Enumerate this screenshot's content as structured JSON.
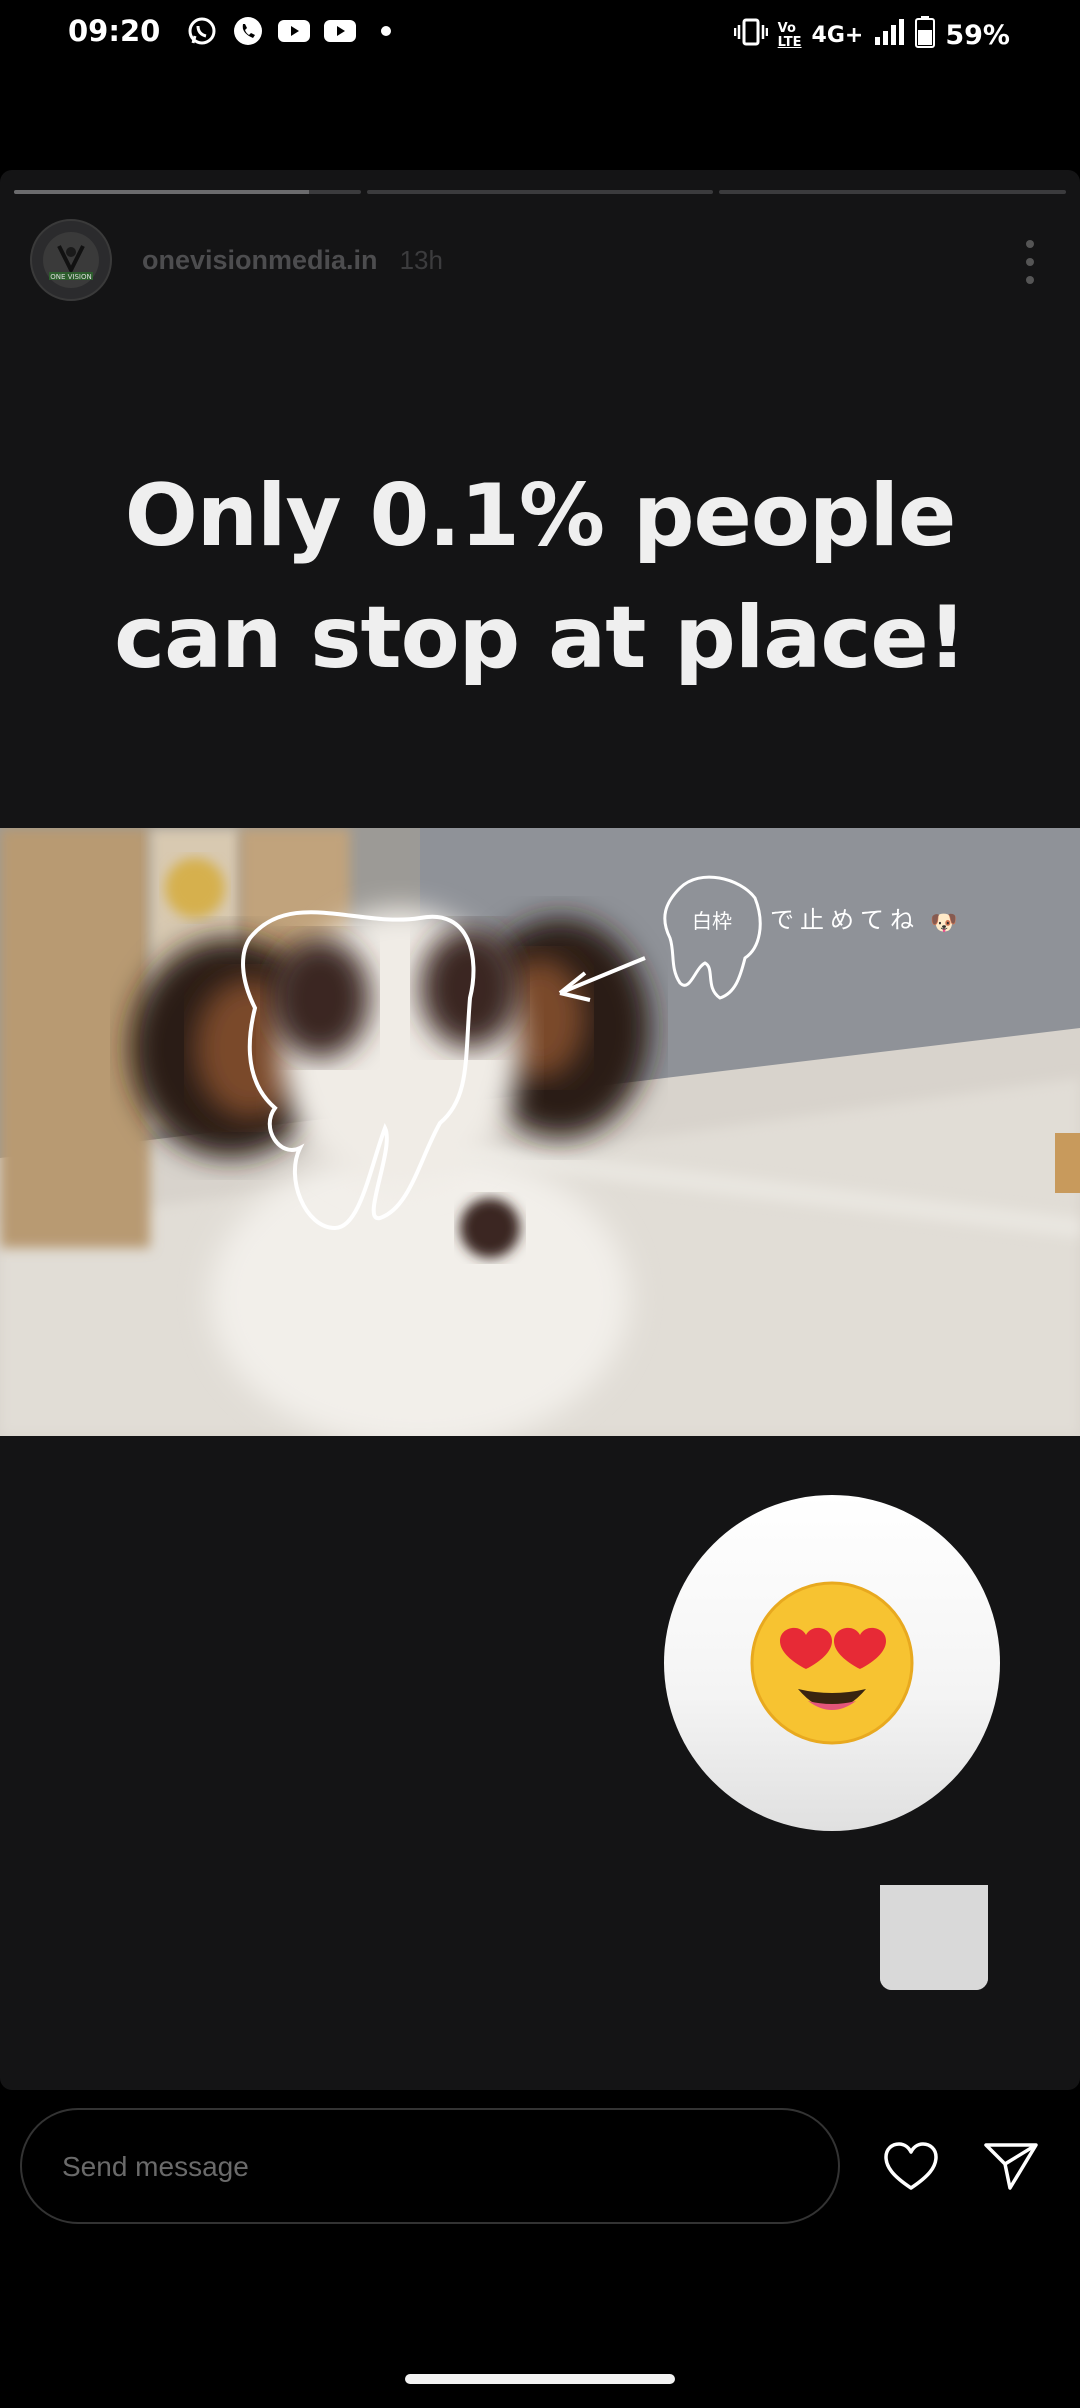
{
  "status_bar": {
    "time": "09:20",
    "notifications": [
      "whatsapp-icon",
      "phone-icon",
      "youtube-icon",
      "youtube-icon",
      "dot-icon"
    ],
    "network_vo": "Vo",
    "network_lte": "LTE",
    "network_type": "4G+",
    "battery_percent": "59%"
  },
  "story": {
    "progress": [
      0.85,
      0.0,
      0.0
    ],
    "author": "onevisionmedia.in",
    "time_ago": "13h",
    "avatar_text": "ONE VISION",
    "headline_line1": "Only 0.1% people",
    "headline_line2": "can stop at place!",
    "video_annotation_box": "白枠",
    "video_annotation_text": "で止めてね",
    "reaction_emoji": "😍"
  },
  "composer": {
    "placeholder": "Send message"
  },
  "colors": {
    "background": "#000000",
    "story_bg": "#141415",
    "headline": "#efefef"
  }
}
